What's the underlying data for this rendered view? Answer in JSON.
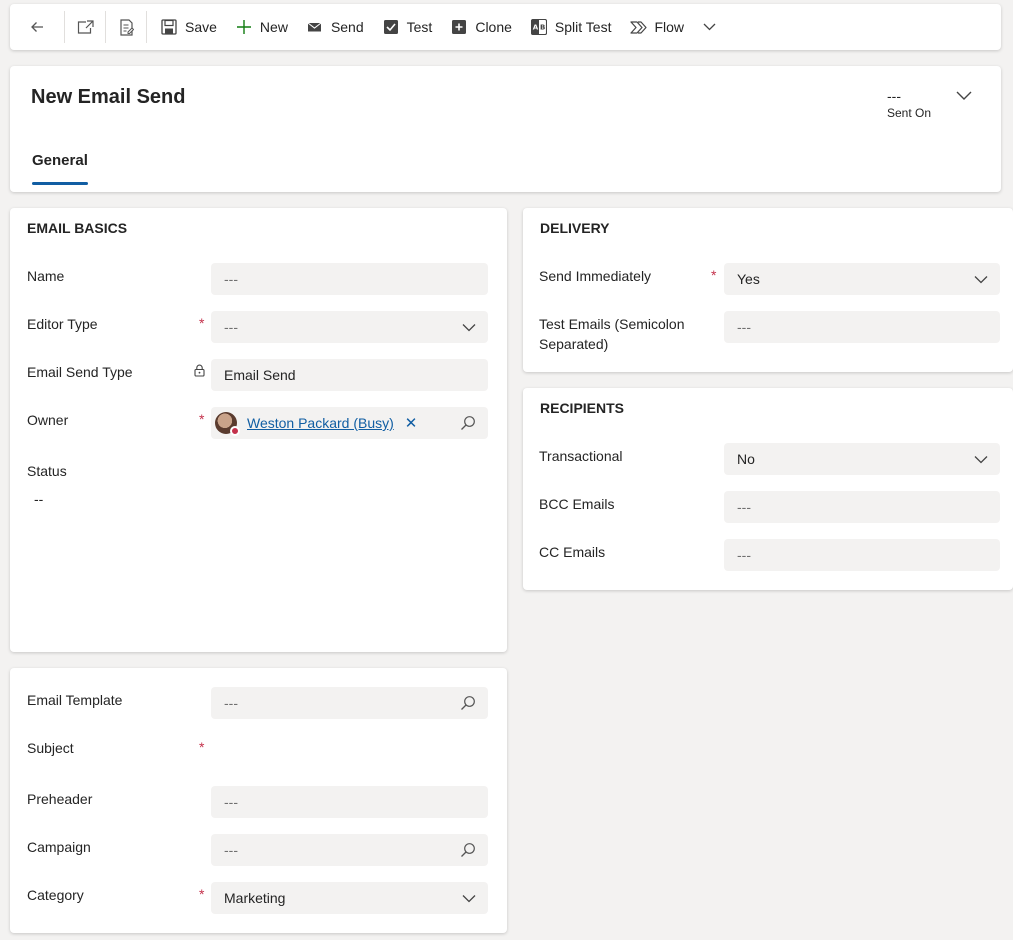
{
  "toolbar": {
    "items": [
      {
        "label": "Save",
        "icon": "save-icon"
      },
      {
        "label": "New",
        "icon": "plus-icon"
      },
      {
        "label": "Send",
        "icon": "envelope-icon"
      },
      {
        "label": "Test",
        "icon": "checkbox-icon"
      },
      {
        "label": "Clone",
        "icon": "clone-icon"
      },
      {
        "label": "Split Test",
        "icon": "split-test-icon"
      },
      {
        "label": "Flow",
        "icon": "flow-icon"
      }
    ]
  },
  "header": {
    "title": "New Email Send",
    "sent_on_value": "---",
    "sent_on_label": "Sent On",
    "tab": "General"
  },
  "email_basics": {
    "title": "EMAIL BASICS",
    "name_label": "Name",
    "name_value": "---",
    "editor_type_label": "Editor Type",
    "editor_type_value": "---",
    "email_send_type_label": "Email Send Type",
    "email_send_type_value": "Email Send",
    "owner_label": "Owner",
    "owner_value": "Weston Packard (Busy)",
    "owner_remove": "✕",
    "status_label": "Status",
    "status_value": "--"
  },
  "content": {
    "email_template_label": "Email Template",
    "email_template_value": "---",
    "subject_label": "Subject",
    "preheader_label": "Preheader",
    "preheader_value": "---",
    "campaign_label": "Campaign",
    "campaign_value": "---",
    "category_label": "Category",
    "category_value": "Marketing"
  },
  "delivery": {
    "title": "DELIVERY",
    "send_immediately_label": "Send Immediately",
    "send_immediately_value": "Yes",
    "test_emails_label_1": "Test Emails (Semicolon",
    "test_emails_label_2": "Separated)",
    "test_emails_value": "---"
  },
  "recipients": {
    "title": "RECIPIENTS",
    "transactional_label": "Transactional",
    "transactional_value": "No",
    "bcc_label": "BCC Emails",
    "bcc_value": "---",
    "cc_label": "CC Emails",
    "cc_value": "---"
  },
  "required_marker": "*",
  "colors": {
    "accent": "#115ea3",
    "required": "#c4314b",
    "field_bg": "#f3f2f1",
    "new_icon": "#107c10"
  }
}
